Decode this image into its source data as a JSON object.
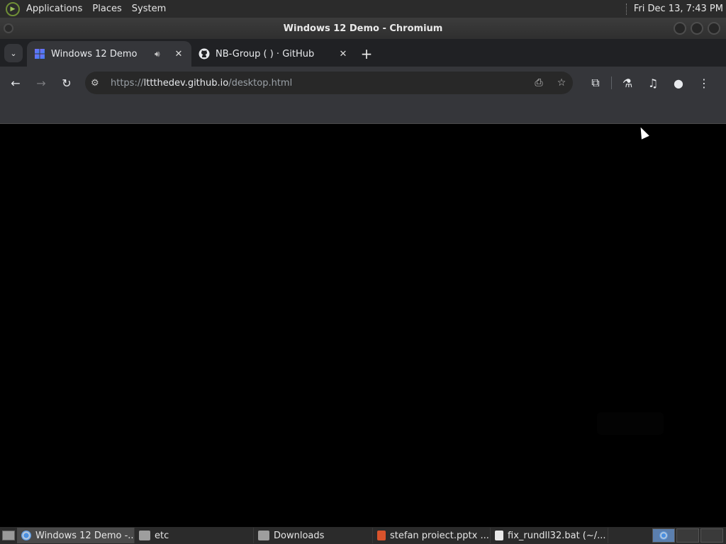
{
  "top_panel": {
    "menus": [
      "Applications",
      "Places",
      "System"
    ],
    "clock": "Fri Dec 13,  7:43 PM"
  },
  "window": {
    "title": "Windows 12 Demo - Chromium"
  },
  "tabs": [
    {
      "title": "Windows 12 Demo",
      "favicon": "windows12-logo-icon",
      "audio": true,
      "active": true
    },
    {
      "title": "NB-Group (       ) · GitHub",
      "favicon": "github-icon",
      "audio": false,
      "active": false
    }
  ],
  "toolbar": {
    "url_scheme": "https://",
    "url_host": "lttthedev.github.io",
    "url_path": "/desktop.html"
  },
  "taskbar": {
    "items": [
      {
        "label": "Windows 12 Demo -...",
        "icon": "chromium-icon",
        "active": true
      },
      {
        "label": "etc",
        "icon": "folder-icon",
        "active": false
      },
      {
        "label": "Downloads",
        "icon": "folder-icon",
        "active": false
      },
      {
        "label": "stefan proiect.pptx ...",
        "icon": "presentation-icon",
        "active": false
      },
      {
        "label": "fix_rundll32.bat (~/...",
        "icon": "text-editor-icon",
        "active": false
      }
    ]
  },
  "colors": {
    "panel": "#2b2b2b",
    "tab_active": "#35363a",
    "page_background": "#000000"
  }
}
